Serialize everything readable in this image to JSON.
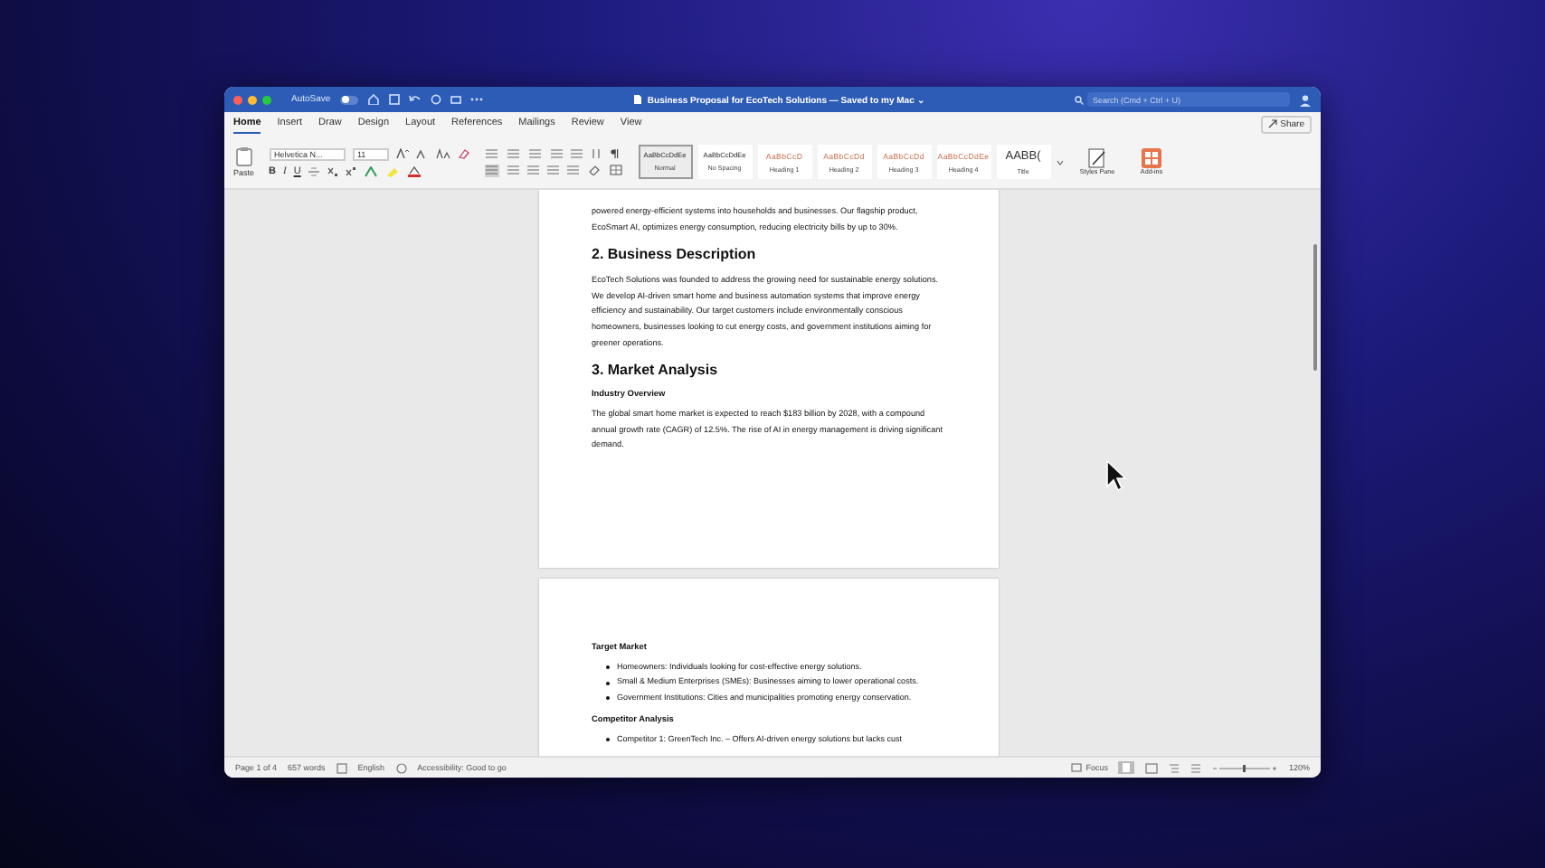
{
  "window": {
    "title": "Business Proposal for EcoTech Solutions — Saved to my Mac ⌄",
    "autosave": {
      "label": "AutoSave",
      "on": false
    },
    "search": {
      "placeholder": "Search (Cmd + Ctrl + U)"
    }
  },
  "ribbon_tabs": [
    {
      "label": "Home",
      "selected": true
    },
    {
      "label": "Insert",
      "selected": false
    },
    {
      "label": "Draw",
      "selected": false
    },
    {
      "label": "Design",
      "selected": false
    },
    {
      "label": "Layout",
      "selected": false
    },
    {
      "label": "References",
      "selected": false
    },
    {
      "label": "Mailings",
      "selected": false
    },
    {
      "label": "Review",
      "selected": false
    },
    {
      "label": "View",
      "selected": false
    }
  ],
  "share": "Share",
  "clipboard": {
    "label": "Paste"
  },
  "font": {
    "name": "Helvetica N...",
    "size": "11"
  },
  "format_buttons": [
    "B",
    "I",
    "U"
  ],
  "styles": [
    {
      "sample": "AaBbCcDdEe",
      "label": "Normal",
      "selected": true,
      "kind": "body"
    },
    {
      "sample": "AaBbCcDdEe",
      "label": "No Spacing",
      "selected": false,
      "kind": "body"
    },
    {
      "sample": "AaBbCcD",
      "label": "Heading 1",
      "selected": false,
      "kind": "heading"
    },
    {
      "sample": "AaBbCcDd",
      "label": "Heading 2",
      "selected": false,
      "kind": "heading"
    },
    {
      "sample": "AaBbCcDd",
      "label": "Heading 3",
      "selected": false,
      "kind": "heading"
    },
    {
      "sample": "AaBbCcDdEe",
      "label": "Heading 4",
      "selected": false,
      "kind": "heading"
    },
    {
      "sample": "AABB(",
      "label": "Title",
      "selected": false,
      "kind": "title"
    }
  ],
  "panes": [
    {
      "label": "Styles Pane",
      "kind": "styles"
    },
    {
      "label": "Add-ins",
      "kind": "addins"
    }
  ],
  "pages": [
    {
      "blocks": [
        {
          "kind": "paragraph",
          "text": "powered energy-efficient systems into households and businesses. Our flagship product, EcoSmart AI, optimizes energy consumption, reducing electricity bills by up to 30%."
        },
        {
          "kind": "heading",
          "text": "2. Business Description"
        },
        {
          "kind": "paragraph",
          "text": "EcoTech Solutions was founded to address the growing need for sustainable energy solutions. We develop AI-driven smart home and business automation systems that improve energy efficiency and sustainability. Our target customers include environmentally conscious homeowners, businesses looking to cut energy costs, and government institutions aiming for greener operations."
        },
        {
          "kind": "heading",
          "text": "3. Market Analysis"
        },
        {
          "kind": "subheading",
          "text": "Industry Overview"
        },
        {
          "kind": "paragraph",
          "text": "The global smart home market is expected to reach $183 billion by 2028, with a compound annual growth rate (CAGR) of 12.5%. The rise of AI in energy management is driving significant demand."
        }
      ]
    },
    {
      "blocks": [
        {
          "kind": "subheading",
          "text": "Target Market"
        },
        {
          "kind": "bullets",
          "items": [
            "Homeowners: Individuals looking for cost-effective energy solutions.",
            "Small & Medium Enterprises (SMEs): Businesses aiming to lower operational costs.",
            "Government Institutions: Cities and municipalities promoting energy conservation."
          ]
        },
        {
          "kind": "subheading",
          "text": "Competitor Analysis"
        },
        {
          "kind": "bullets",
          "items": [
            "Competitor 1: GreenTech Inc. – Offers AI-driven energy solutions but lacks cust"
          ]
        }
      ]
    }
  ],
  "status_bar": {
    "items": [
      "Page 1 of 4",
      "657 words",
      "English",
      "Accessibility: Good to go"
    ],
    "focus": "Focus",
    "zoom": "120%"
  }
}
